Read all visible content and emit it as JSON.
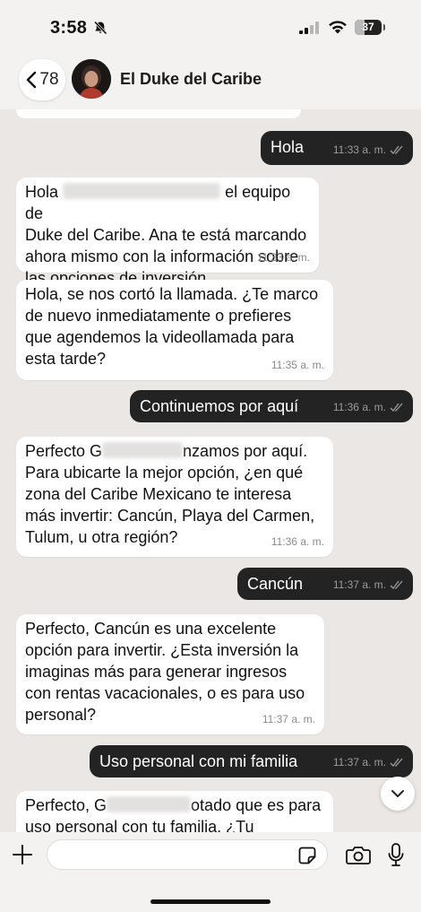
{
  "status_bar": {
    "time": "3:58",
    "battery": "37",
    "battery_level": 0.37
  },
  "header": {
    "back_count": "78",
    "title": "El Duke del Caribe"
  },
  "messages": [
    {
      "direction": "out",
      "text": "Hola",
      "time": "11:33 a. m."
    },
    {
      "direction": "in",
      "text_before": "Hola",
      "text_after": "el equipo de\nDuke del Caribe. Ana te está marcando\nahora mismo con la información sobre\nlas opciones de inversión.",
      "time": "11:33 a. m."
    },
    {
      "direction": "in",
      "text": "Hola, se nos cortó la llamada. ¿Te marco\nde nuevo inmediatamente o prefieres\nque agendemos la videollamada para\nesta tarde?",
      "time": "11:35 a. m."
    },
    {
      "direction": "out",
      "text": "Continuemos por aquí",
      "time": "11:36 a. m."
    },
    {
      "direction": "in",
      "text_before": "Perfecto G",
      "text_after": "nzamos por aquí.\nPara ubicarte la mejor opción, ¿en qué\nzona del Caribe Mexicano te interesa\nmás invertir: Cancún, Playa del Carmen,\nTulum, u otra región?",
      "time": "11:36 a. m."
    },
    {
      "direction": "out",
      "text": "Cancún",
      "time": "11:37 a. m."
    },
    {
      "direction": "in",
      "text": "Perfecto, Cancún es una excelente\nopción para invertir. ¿Esta inversión la\nimaginas más para generar ingresos\ncon rentas vacacionales, o es para uso\npersonal?",
      "time": "11:37 a. m."
    },
    {
      "direction": "out",
      "text": "Uso personal con mi familia",
      "time": "11:37 a. m."
    },
    {
      "direction": "in",
      "text_before": "Perfecto, G",
      "text_after": "otado que es para\nuso personal con tu familia. ¿Tu"
    }
  ],
  "input": {
    "placeholder": "",
    "value": ""
  },
  "icons": {
    "back": "chevron-left-icon",
    "bell": "bell-slash-icon",
    "signal": "signal-icon",
    "wifi": "wifi-icon",
    "read": "double-check-icon",
    "scroll": "chevron-down-icon",
    "plus": "plus-icon",
    "sticker": "sticker-icon",
    "camera": "camera-icon",
    "mic": "microphone-icon"
  },
  "colors": {
    "chat_bg": "#ebe7e4",
    "outgoing": "#232323",
    "incoming": "#ffffff",
    "bar": "#f4f2f1"
  }
}
